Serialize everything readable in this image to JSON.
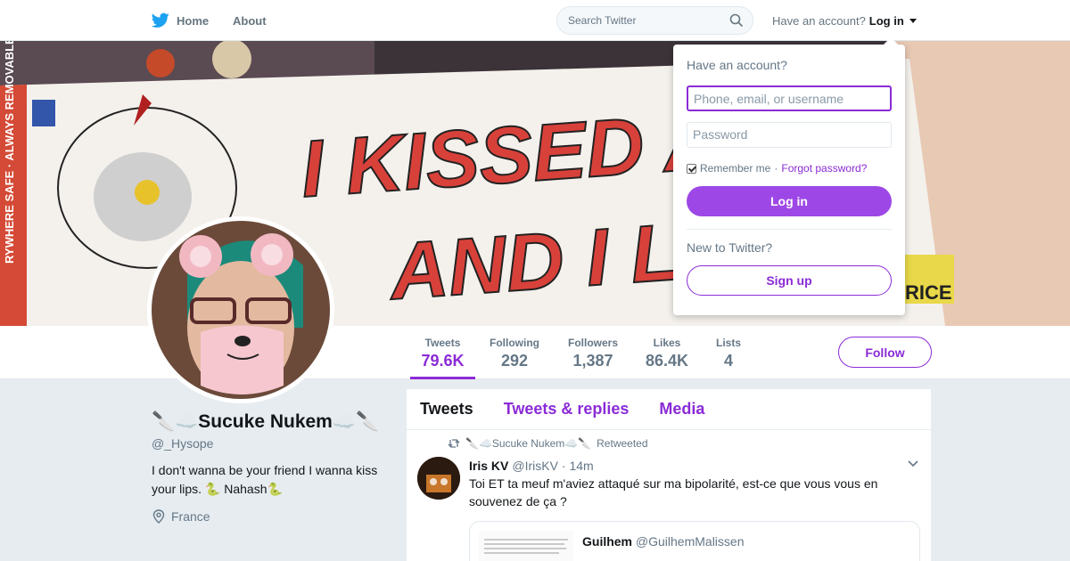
{
  "topbar": {
    "home_label": "Home",
    "about_label": "About",
    "search_placeholder": "Search Twitter",
    "have_account": "Have an account?",
    "login_label": "Log in"
  },
  "banner": {
    "sticker_line1": "I KISSED A",
    "sticker_line2": "AND I LIK",
    "sticker_side": "RYWHERE SAFE · ALWAYS REMOVABLE",
    "corner_text": "RICE"
  },
  "stats": [
    {
      "label": "Tweets",
      "value": "79.6K",
      "active": true
    },
    {
      "label": "Following",
      "value": "292"
    },
    {
      "label": "Followers",
      "value": "1,387"
    },
    {
      "label": "Likes",
      "value": "86.4K"
    },
    {
      "label": "Lists",
      "value": "4"
    }
  ],
  "follow_label": "Follow",
  "profile": {
    "name": "🔪☁️Sucuke Nukem☁️🔪",
    "handle": "@_Hysope",
    "bio": "I don't wanna be your friend I wanna kiss your lips. 🐍 Nahash🐍",
    "location": "France"
  },
  "timeline": {
    "tabs": [
      "Tweets",
      "Tweets & replies",
      "Media"
    ],
    "tweet": {
      "retweet_by": "🔪☁️Sucuke Nukem☁️🔪",
      "retweet_suffix": "Retweeted",
      "author": "Iris KV",
      "handle": "@IrisKV",
      "time": "· 14m",
      "text": "Toi ET ta meuf m'aviez attaqué sur ma bipolarité, est-ce que vous vous en souvenez de ça ?",
      "quote_author": "Guilhem",
      "quote_handle": "@GuilhemMalissen"
    }
  },
  "login_dropdown": {
    "title": "Have an account?",
    "username_placeholder": "Phone, email, or username",
    "password_placeholder": "Password",
    "remember_label": "Remember me",
    "forgot_label": "Forgot password?",
    "login_button": "Log in",
    "new_label": "New to Twitter?",
    "signup_button": "Sign up"
  },
  "colors": {
    "accent": "#8b2bd6",
    "login_button_bg": "#9d48e6",
    "background": "#e6ecf0"
  }
}
